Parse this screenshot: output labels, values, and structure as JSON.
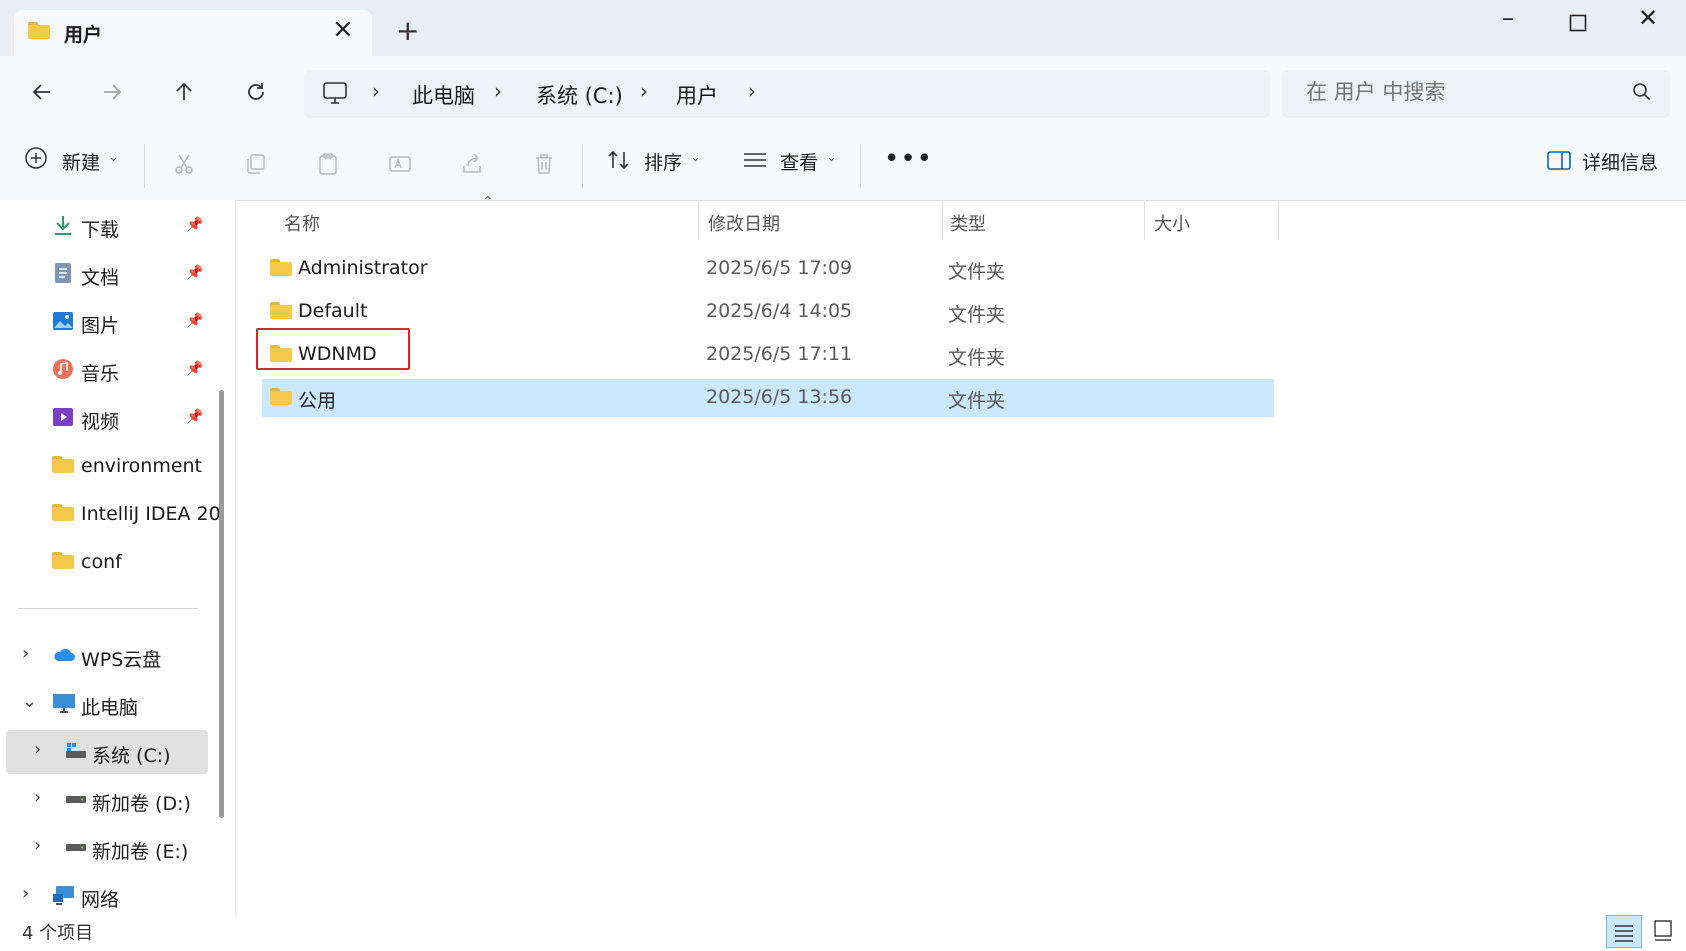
{
  "tab": {
    "title": "用户"
  },
  "address": {
    "crumbs": [
      "此电脑",
      "系统 (C:)",
      "用户"
    ]
  },
  "search": {
    "placeholder": "在 用户 中搜索"
  },
  "command_bar": {
    "new_label": "新建",
    "sort_label": "排序",
    "view_label": "查看",
    "details_label": "详细信息"
  },
  "sidebar": {
    "quick_access": [
      {
        "label": "下载",
        "icon": "download-icon",
        "pinned": true
      },
      {
        "label": "文档",
        "icon": "document-icon",
        "pinned": true
      },
      {
        "label": "图片",
        "icon": "pictures-icon",
        "pinned": true
      },
      {
        "label": "音乐",
        "icon": "music-icon",
        "pinned": true
      },
      {
        "label": "视频",
        "icon": "videos-icon",
        "pinned": true
      },
      {
        "label": "environment",
        "icon": "folder-icon",
        "pinned": false
      },
      {
        "label": "IntelliJ IDEA 20",
        "icon": "folder-icon",
        "pinned": false
      },
      {
        "label": "conf",
        "icon": "folder-icon",
        "pinned": false
      }
    ],
    "tree": [
      {
        "label": "WPS云盘",
        "icon": "cloud-icon"
      },
      {
        "label": "此电脑",
        "icon": "computer-icon",
        "expanded": true
      },
      {
        "label": "系统 (C:)",
        "icon": "drive-icon",
        "selected": true
      },
      {
        "label": "新加卷 (D:)",
        "icon": "drive-icon"
      },
      {
        "label": "新加卷 (E:)",
        "icon": "drive-icon"
      },
      {
        "label": "网络",
        "icon": "network-icon"
      }
    ]
  },
  "columns": {
    "name": "名称",
    "modified": "修改日期",
    "type": "类型",
    "size": "大小"
  },
  "files": [
    {
      "name": "Administrator",
      "modified": "2025/6/5 17:09",
      "type": "文件夹"
    },
    {
      "name": "Default",
      "modified": "2025/6/4 14:05",
      "type": "文件夹"
    },
    {
      "name": "WDNMD",
      "modified": "2025/6/5 17:11",
      "type": "文件夹"
    },
    {
      "name": "公用",
      "modified": "2025/6/5 13:56",
      "type": "文件夹"
    }
  ],
  "status": {
    "item_count": "4 个项目"
  },
  "colors": {
    "accent": "#0067c0",
    "selection": "#cce8ff",
    "highlight_box": "#e1242b",
    "folder": "#f7c94b"
  }
}
